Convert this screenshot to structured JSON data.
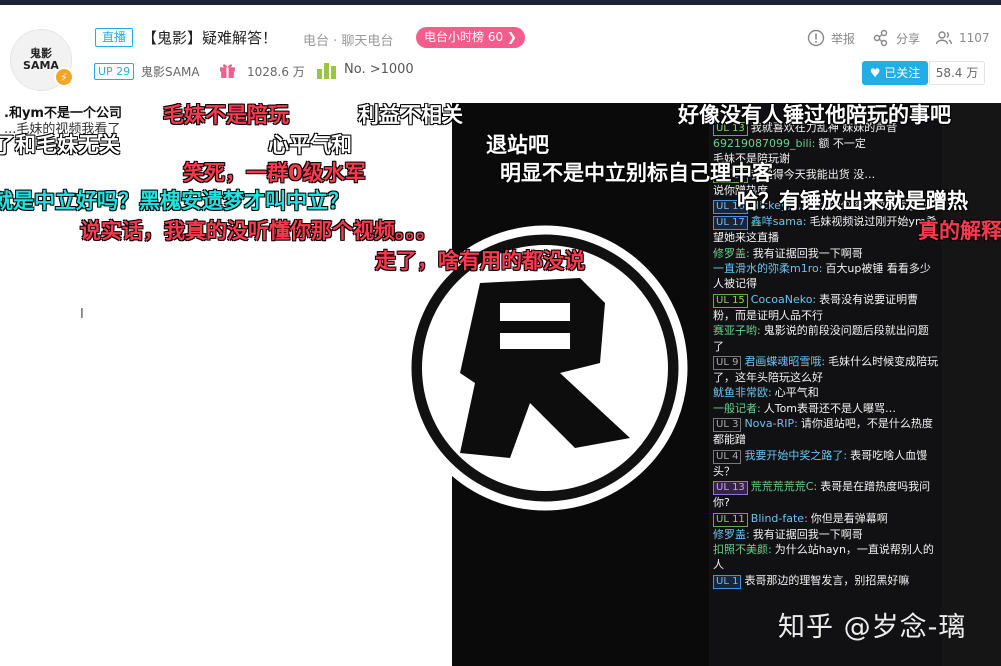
{
  "header": {
    "avatar_text": "鬼影 SAMA",
    "live_tag": "直播",
    "room_title": "【鬼影】疑难解答！",
    "breadcrumb": "电台 · 聊天电台",
    "rank_pill": "电台小时榜 60 ❯",
    "up_level": "UP 29",
    "up_name": "鬼影SAMA",
    "gift_count": "1028.6 万",
    "rank_no": "No. >1000",
    "report_label": "举报",
    "share_label": "分享",
    "viewer_count": "1107",
    "follow_label": "♥ 已关注",
    "follower_count": "58.4 万"
  },
  "left_panel": {
    "line1": ".和ym不是一个公司",
    "line2": "...毛妹的视频我看了"
  },
  "danmaku": [
    {
      "text": "毛妹不是陪玩",
      "color": "red"
    },
    {
      "text": "利益不相关",
      "color": "white"
    },
    {
      "text": "好像没有人锤过他陪玩的事吧",
      "color": "white"
    },
    {
      "text": "了和毛妹无关",
      "color": "white"
    },
    {
      "text": "心平气和",
      "color": "white"
    },
    {
      "text": "退站吧",
      "color": "white"
    },
    {
      "text": "笑死，一群0级水军",
      "color": "red"
    },
    {
      "text": "明显不是中立别标自己理中客",
      "color": "white"
    },
    {
      "text": "就是中立好吗？黑槐安遗梦才叫中立？",
      "color": "cyan"
    },
    {
      "text": "哈？有锤放出来就是蹭热",
      "color": "white"
    },
    {
      "text": "说实话，我真的没听懂你那个视频。。。",
      "color": "red"
    },
    {
      "text": "真的解释",
      "color": "red"
    },
    {
      "text": "走了，啥有用的都没说",
      "color": "red"
    }
  ],
  "chat": [
    {
      "medal": "UL 13",
      "medal_style": "green",
      "name": "",
      "text": "我就喜欢在力乱神 妹妹的声音"
    },
    {
      "medal": "",
      "medal_style": "",
      "name": "69219087099_bili",
      "text": "额 不一定"
    },
    {
      "medal": "",
      "medal_style": "",
      "name": "",
      "text": "毛妹不是陪玩谢"
    },
    {
      "medal": "UL 11",
      "medal_style": "green",
      "name": "",
      "text": "我觉得今天我能出货 没…"
    },
    {
      "medal": "",
      "medal_style": "",
      "name": "",
      "text": "说你蹭热度"
    },
    {
      "medal": "UL 16",
      "medal_style": "blue",
      "name": "Hickey,,,,Kiss",
      "text": "两仪滚的动态看了吗"
    },
    {
      "medal": "UL 17",
      "medal_style": "blue",
      "name": "鑫咩sama",
      "text": "毛妹视频说过刚开始ym希望她来这直播"
    },
    {
      "medal": "",
      "medal_style": "",
      "name": "修罗盖",
      "text": "我有证据回我一下啊哥"
    },
    {
      "medal": "",
      "medal_style": "",
      "name": "一直滑水的弥柔m1ro",
      "text": "百大up被锤 看看多少人被记得"
    },
    {
      "medal": "UL 15",
      "medal_style": "green",
      "name": "CocoaNeko",
      "text": "表哥没有说要证明曹粉，而是证明人品不行"
    },
    {
      "medal": "",
      "medal_style": "",
      "name": "赛亚子哟",
      "text": "鬼影说的前段没问题后段就出问题了"
    },
    {
      "medal": "UL 9",
      "medal_style": "gray",
      "name": "君画蝶魂昭雪哦",
      "text": "毛妹什么时候变成陪玩了，这年头陪玩这么好"
    },
    {
      "medal": "",
      "medal_style": "",
      "name": "鱿鱼非常欧",
      "text": "心平气和"
    },
    {
      "medal": "",
      "medal_style": "",
      "name": "一般记者",
      "text": "人Tom表哥还不是人曝骂…"
    },
    {
      "medal": "UL 3",
      "medal_style": "gray",
      "name": "Nova-RIP",
      "text": "请你退站吧，不是什么热度都能蹭"
    },
    {
      "medal": "UL 4",
      "medal_style": "gray",
      "name": "我要开始中奖之路了",
      "text": "表哥吃啥人血馒头？"
    },
    {
      "medal": "UL 13",
      "medal_style": "purple",
      "name": "荒荒荒荒荒C",
      "text": "表哥是在蹭热度吗我问你?"
    },
    {
      "medal": "UL 11",
      "medal_style": "green",
      "name": "Blind-fate",
      "text": "你但是看弹幕啊"
    },
    {
      "medal": "",
      "medal_style": "",
      "name": "修罗盖",
      "text": "我有证据回我一下啊哥"
    },
    {
      "medal": "",
      "medal_style": "",
      "name": "扣照不美颜",
      "text": "为什么站hayn，一直说帮别人的人"
    },
    {
      "medal": "UL 1",
      "medal_style": "blue",
      "name": "",
      "text": "表哥那边的理智发言，别招黑好嘛"
    }
  ],
  "watermark": "知乎 @岁念-璃",
  "colors": {
    "accent": "#23ade5",
    "pink": "#f25d8e",
    "danmaku_red": "#ff3a4f",
    "danmaku_cyan": "#1fe3e0"
  }
}
